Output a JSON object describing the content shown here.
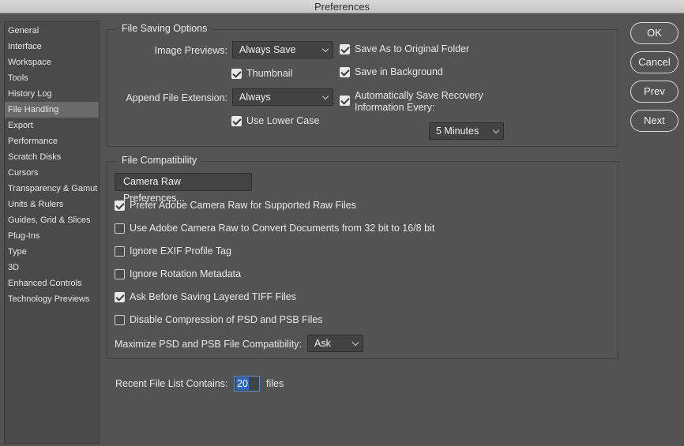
{
  "window": {
    "title": "Preferences"
  },
  "sidebar": {
    "items": [
      {
        "label": "General"
      },
      {
        "label": "Interface"
      },
      {
        "label": "Workspace"
      },
      {
        "label": "Tools"
      },
      {
        "label": "History Log"
      },
      {
        "label": "File Handling",
        "selected": true
      },
      {
        "label": "Export"
      },
      {
        "label": "Performance"
      },
      {
        "label": "Scratch Disks"
      },
      {
        "label": "Cursors"
      },
      {
        "label": "Transparency & Gamut"
      },
      {
        "label": "Units & Rulers"
      },
      {
        "label": "Guides, Grid & Slices"
      },
      {
        "label": "Plug-Ins"
      },
      {
        "label": "Type"
      },
      {
        "label": "3D"
      },
      {
        "label": "Enhanced Controls"
      },
      {
        "label": "Technology Previews"
      }
    ]
  },
  "file_saving": {
    "title": "File Saving Options",
    "image_previews_label": "Image Previews:",
    "image_previews_value": "Always Save",
    "thumbnail_label": "Thumbnail",
    "thumbnail_checked": true,
    "append_ext_label": "Append File Extension:",
    "append_ext_value": "Always",
    "lower_case_label": "Use Lower Case",
    "lower_case_checked": true,
    "save_original_label": "Save As to Original Folder",
    "save_original_checked": true,
    "save_background_label": "Save in Background",
    "save_background_checked": true,
    "auto_save_label_1": "Automatically Save Recovery",
    "auto_save_label_2": "Information Every:",
    "auto_save_checked": true,
    "auto_save_interval": "5 Minutes"
  },
  "compat": {
    "title": "File Compatibility",
    "camera_raw_button": "Camera Raw Preferences...",
    "options": [
      {
        "label": "Prefer Adobe Camera Raw for Supported Raw Files",
        "checked": true
      },
      {
        "label": "Use Adobe Camera Raw to Convert Documents from 32 bit to 16/8 bit",
        "checked": false
      },
      {
        "label": "Ignore EXIF Profile Tag",
        "checked": false
      },
      {
        "label": "Ignore Rotation Metadata",
        "checked": false
      },
      {
        "label": "Ask Before Saving Layered TIFF Files",
        "checked": true
      },
      {
        "label": "Disable Compression of PSD and PSB Files",
        "checked": false
      }
    ],
    "maximize_label": "Maximize PSD and PSB File Compatibility:",
    "maximize_value": "Ask"
  },
  "recent": {
    "label": "Recent File List Contains:",
    "value": "20",
    "suffix": "files"
  },
  "buttons": {
    "ok": "OK",
    "cancel": "Cancel",
    "prev": "Prev",
    "next": "Next"
  }
}
